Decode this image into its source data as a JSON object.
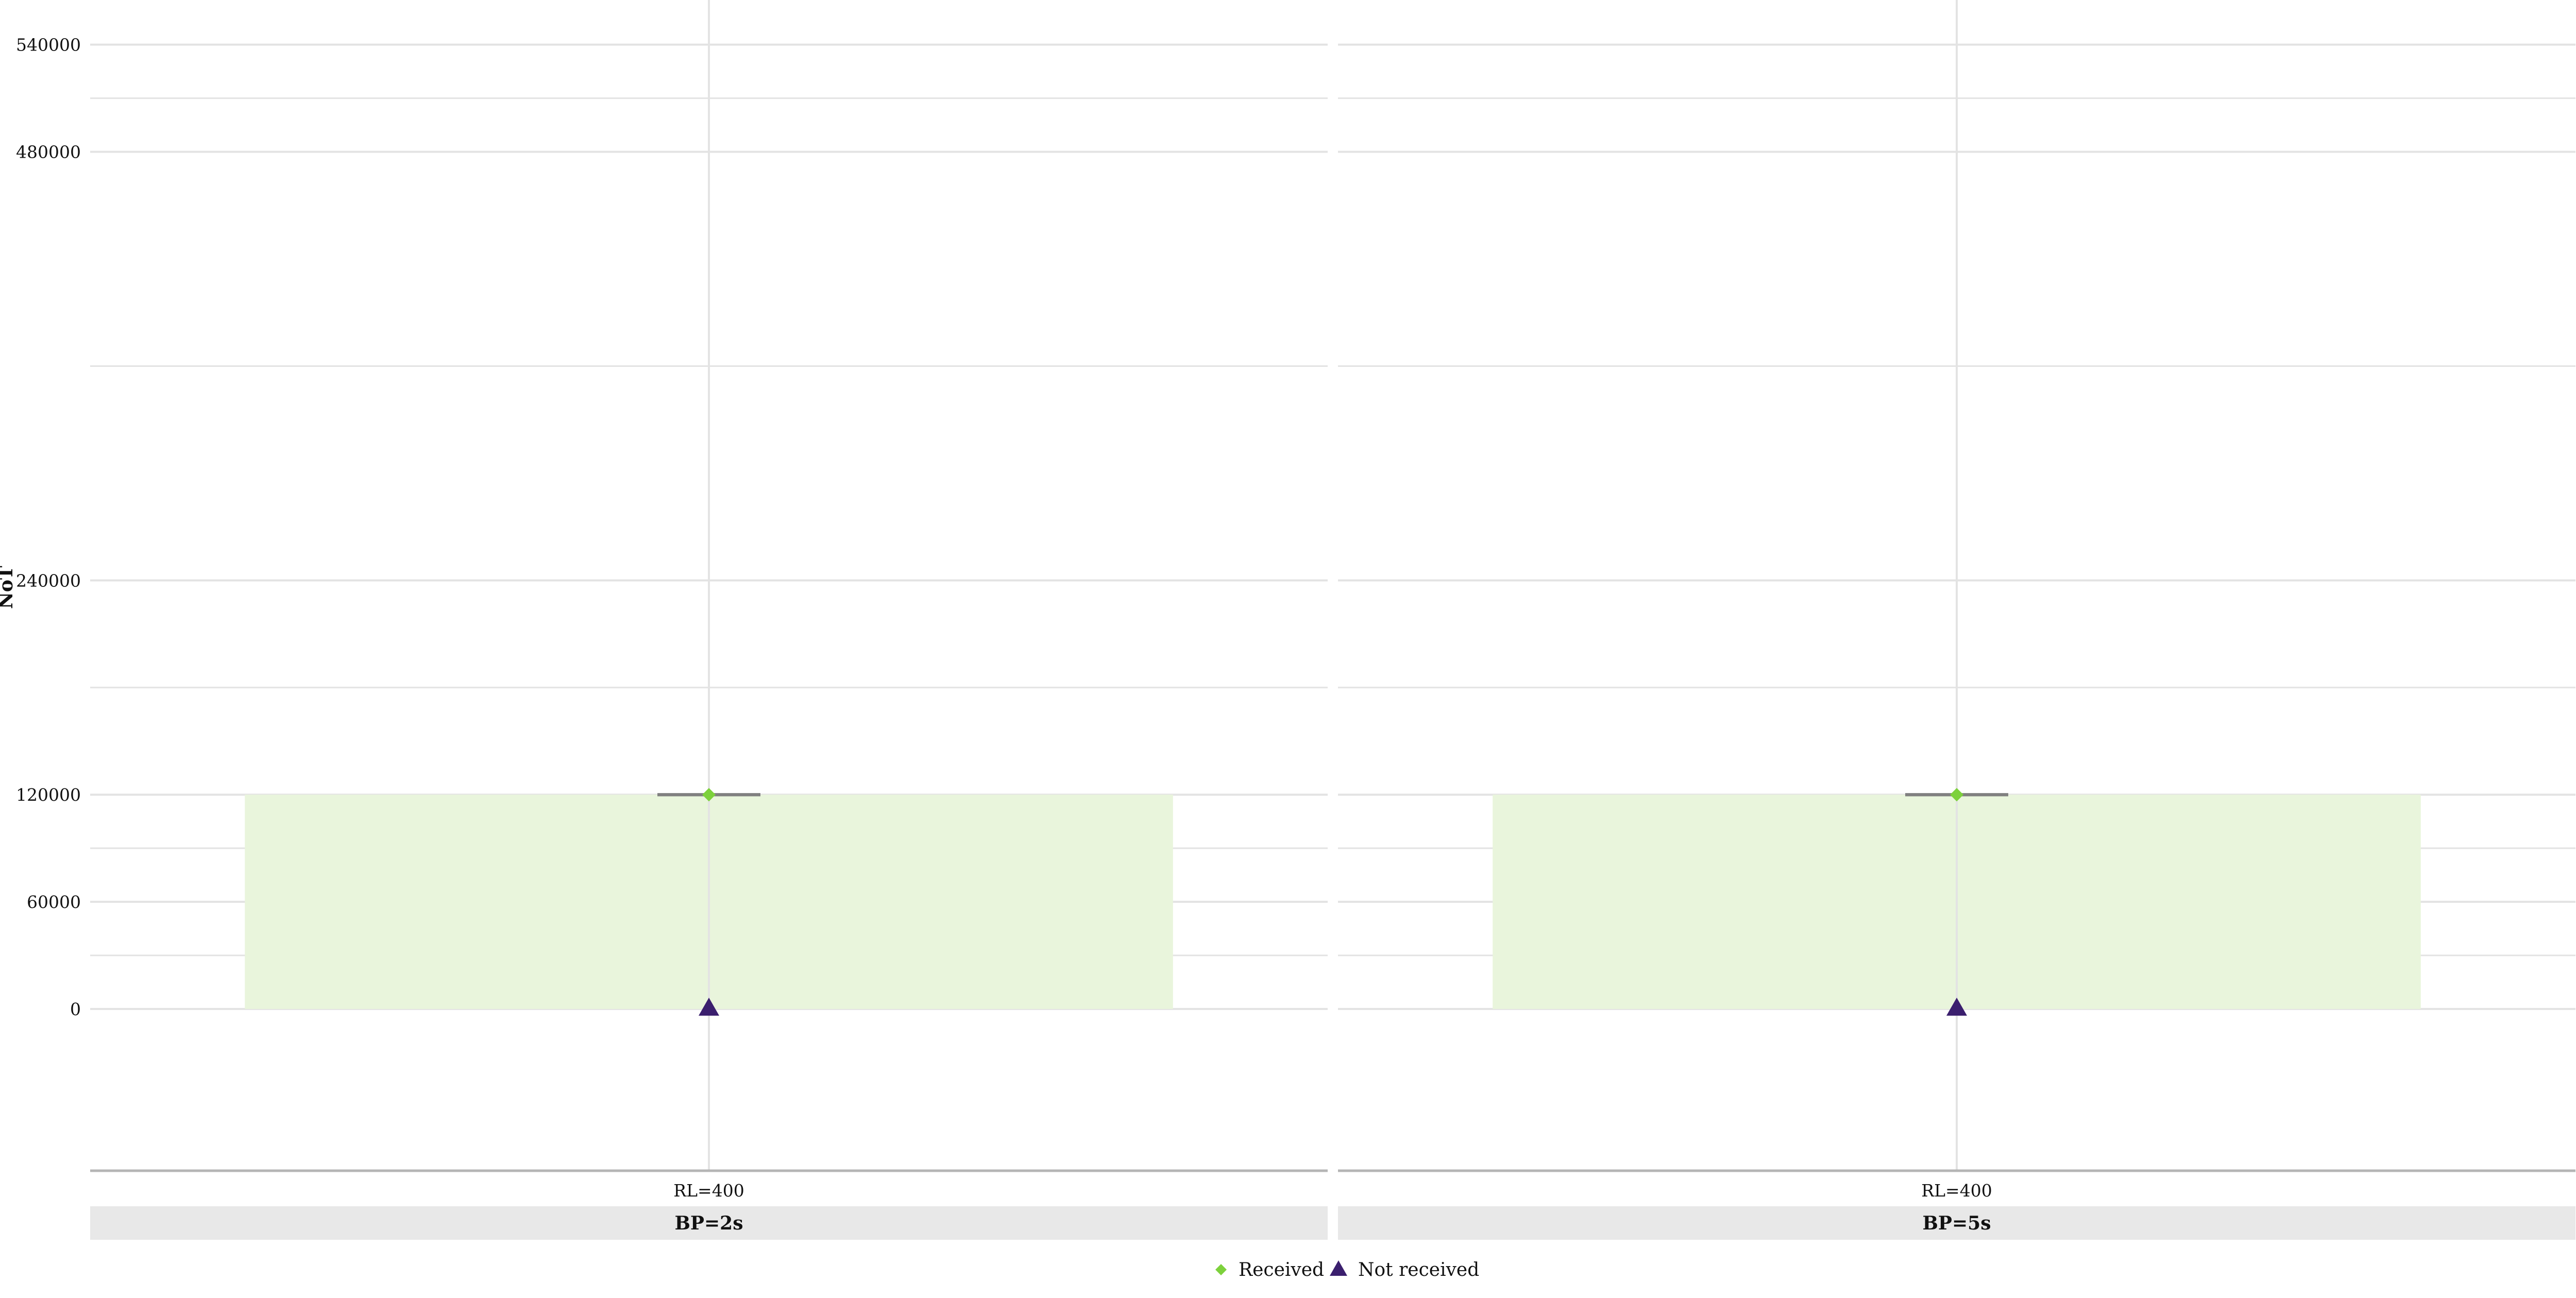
{
  "chart_data": {
    "type": "bar",
    "ylabel": "NoT",
    "ylim": [
      -90000,
      565000
    ],
    "y_ticks": [
      0,
      60000,
      120000,
      240000,
      480000,
      540000
    ],
    "y_tick_labels": [
      "0",
      "60000",
      "120000",
      "240000",
      "480000",
      "540000"
    ],
    "y_minor_ticks": [
      30000,
      90000,
      180000,
      360000,
      510000
    ],
    "grid": true,
    "legend_position": "bottom",
    "series": [
      {
        "name": "Received",
        "color": "#7dd13c",
        "marker": "diamond"
      },
      {
        "name": "Not received",
        "color": "#3b1f6e",
        "marker": "triangle"
      }
    ],
    "panels": [
      {
        "strip": "BP=2s",
        "categories": [
          "RL=400"
        ],
        "bar_values": [
          120000
        ],
        "errorbar": [
          {
            "low": 120000,
            "high": 120000
          }
        ],
        "points": [
          {
            "series": "Received",
            "category": "RL=400",
            "value": 120000
          },
          {
            "series": "Not received",
            "category": "RL=400",
            "value": 0
          }
        ]
      },
      {
        "strip": "BP=5s",
        "categories": [
          "RL=400"
        ],
        "bar_values": [
          120000
        ],
        "errorbar": [
          {
            "low": 120000,
            "high": 120000
          }
        ],
        "points": [
          {
            "series": "Received",
            "category": "RL=400",
            "value": 120000
          },
          {
            "series": "Not received",
            "category": "RL=400",
            "value": 0
          }
        ]
      }
    ],
    "colors": {
      "bar_fill": "#e9f5dc",
      "grid": "#e3e3e3",
      "axis_line": "#b5b5b5",
      "strip_fill": "#e8e8e8",
      "errorbar": "#808080"
    }
  }
}
